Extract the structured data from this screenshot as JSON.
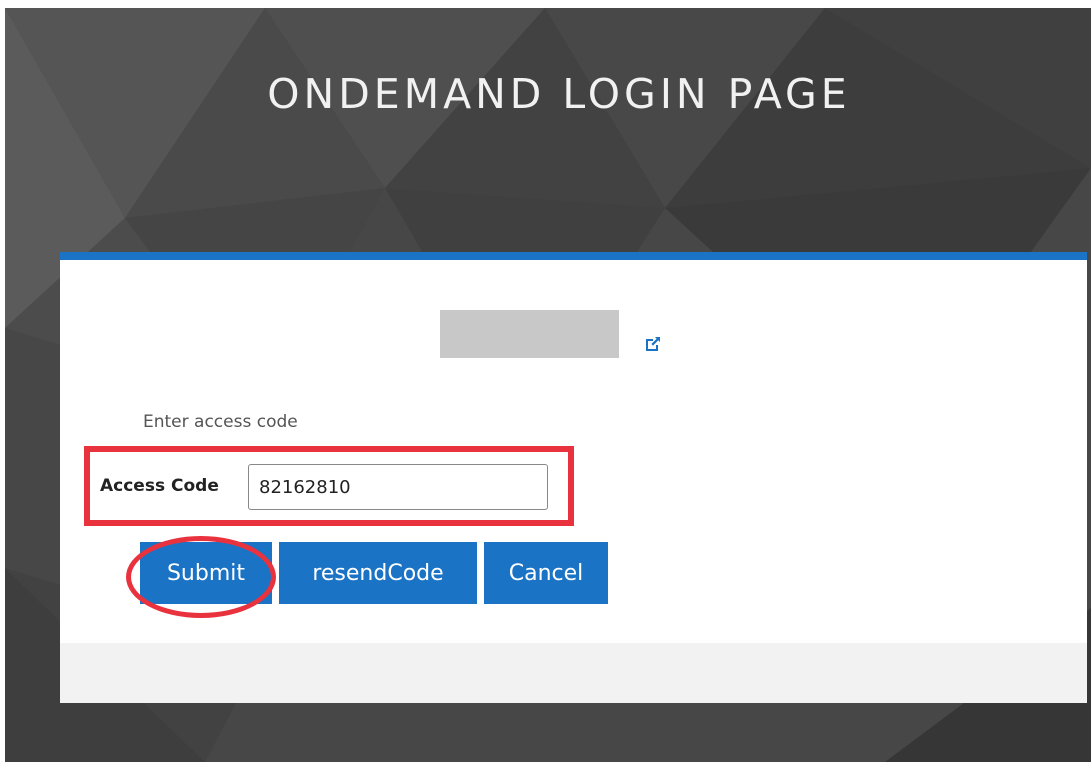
{
  "page": {
    "title": "ONDEMAND LOGIN PAGE"
  },
  "card": {
    "logo": "redacted-logo-placeholder",
    "external_link_icon": "external-link-icon",
    "prompt": "Enter access code",
    "access_code": {
      "label": "Access Code",
      "value": "82162810"
    },
    "buttons": {
      "submit": "Submit",
      "resend": "resendCode",
      "cancel": "Cancel"
    }
  },
  "colors": {
    "accent": "#1a73c4",
    "background": "#474747",
    "annotation": "#e8323e",
    "footer": "#f2f2f2"
  },
  "annotations": {
    "highlight_box": "access-code-row",
    "highlight_circle": "submit-button"
  }
}
